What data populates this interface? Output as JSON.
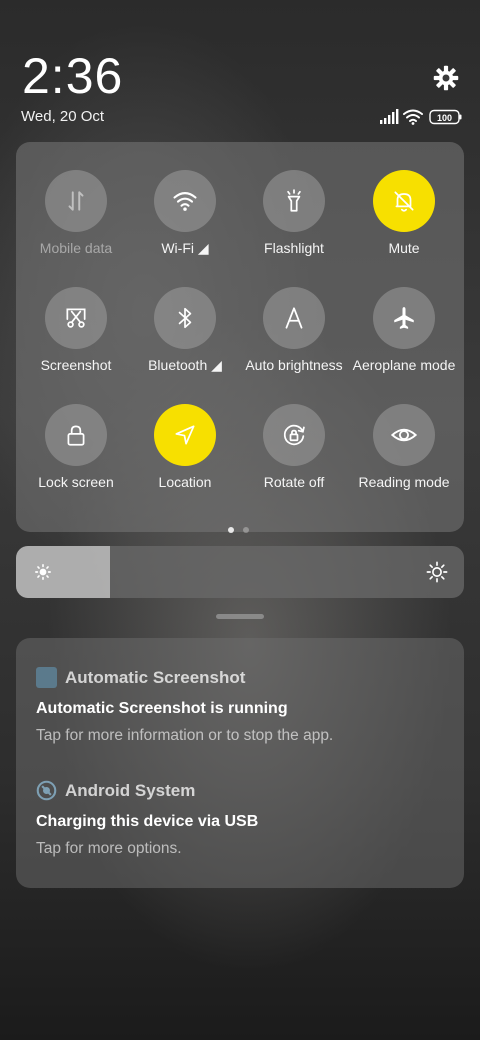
{
  "status_bar": {
    "time": "2:36",
    "date": "Wed, 20 Oct",
    "battery": "100",
    "icons": [
      "signal-icon",
      "wifi-icon",
      "battery-icon",
      "gear-icon"
    ]
  },
  "quick_tiles": [
    {
      "label": "Mobile data",
      "icon": "mobile-data-icon",
      "active": false,
      "disabled": true
    },
    {
      "label": "Wi-Fi ◢",
      "icon": "wifi-icon",
      "active": false
    },
    {
      "label": "Flashlight",
      "icon": "flashlight-icon",
      "active": false
    },
    {
      "label": "Mute",
      "icon": "bell-off-icon",
      "active": true
    },
    {
      "label": "Screenshot",
      "icon": "screenshot-icon",
      "active": false
    },
    {
      "label": "Bluetooth ◢",
      "icon": "bluetooth-icon",
      "active": false
    },
    {
      "label": "Auto brightness",
      "icon": "auto-brightness-icon",
      "active": false
    },
    {
      "label": "Aeroplane mode",
      "icon": "airplane-icon",
      "active": false
    },
    {
      "label": "Lock screen",
      "icon": "lock-icon",
      "active": false
    },
    {
      "label": "Location",
      "icon": "location-icon",
      "active": true
    },
    {
      "label": "Rotate off",
      "icon": "rotate-lock-icon",
      "active": false
    },
    {
      "label": "Reading mode",
      "icon": "eye-icon",
      "active": false
    }
  ],
  "page_indicator": {
    "current": 1,
    "total": 2
  },
  "brightness": {
    "level": 0.21,
    "icons": [
      "sun-low-icon",
      "sun-high-icon"
    ]
  },
  "colors": {
    "accent": "#f7e000",
    "panel": "#7a7a7a"
  },
  "notifications": [
    {
      "app": "Automatic Screenshot",
      "icon": "app-square-icon",
      "title": "Automatic Screenshot is running",
      "text": "Tap for more information or to stop the app."
    },
    {
      "app": "Android System",
      "icon": "android-system-icon",
      "title": "Charging this device via USB",
      "text": "Tap for more options."
    }
  ]
}
